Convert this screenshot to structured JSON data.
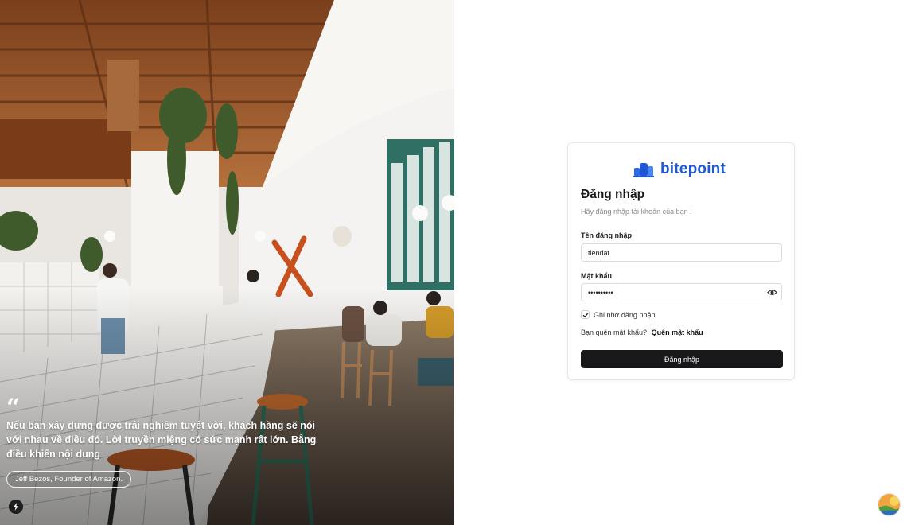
{
  "hero": {
    "quote_mark": "“",
    "quote": "Nếu bạn xây dựng được trải nghiệm tuyệt vời, khách hàng sẽ nói với nhau về điều đó. Lời truyền miệng có sức mạnh rất lớn. Bằng điều khiển nội dung",
    "author": "Jeff Bezos, Founder of Amazon."
  },
  "brand": {
    "name": "bitepoint",
    "color": "#1f57d6"
  },
  "login": {
    "title": "Đăng nhập",
    "subtitle": "Hãy đăng nhập tài khoản của bạn !",
    "username_label": "Tên đăng nhập",
    "username_value": "tiendat",
    "password_label": "Mật khẩu",
    "password_value": "••••••••••",
    "remember_label": "Ghi nhớ đăng nhập",
    "remember_checked": true,
    "forgot_prompt": "Bạn quên mật khẩu?",
    "forgot_link": "Quên mật khẩu",
    "submit_label": "Đăng nhập"
  },
  "icons": {
    "quote": "quote-icon",
    "bolt": "bolt-icon",
    "eye": "eye-icon",
    "check": "check-icon",
    "avatar": "avatar-icon",
    "logo": "bitepoint-logo-icon"
  }
}
